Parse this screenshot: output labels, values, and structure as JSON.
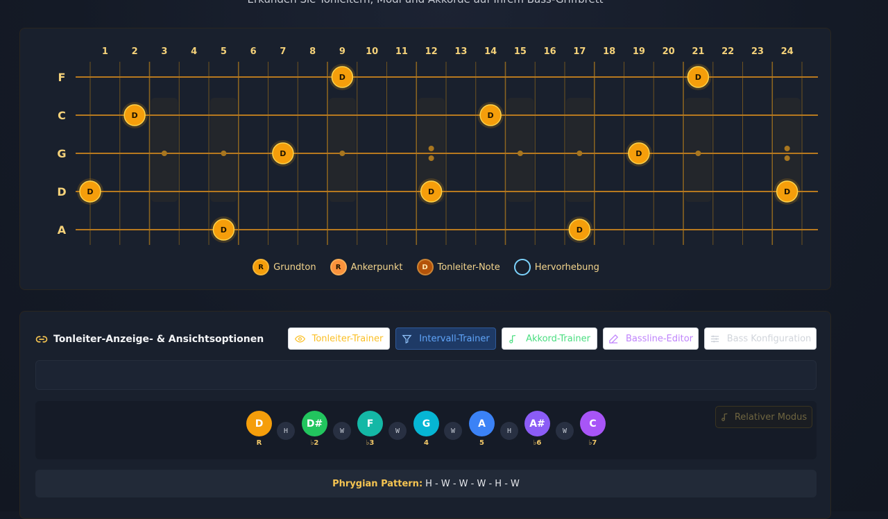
{
  "header": {
    "subtitle": "Erkunden Sie Tonleitern, Modi und Akkorde auf Ihrem Bass-Griffbrett"
  },
  "fretboard": {
    "fret_numbers": [
      "1",
      "2",
      "3",
      "4",
      "5",
      "6",
      "7",
      "8",
      "9",
      "10",
      "11",
      "12",
      "13",
      "14",
      "15",
      "16",
      "17",
      "18",
      "19",
      "20",
      "21",
      "22",
      "23",
      "24"
    ],
    "strings": [
      {
        "name": "F",
        "notes": [
          9,
          21
        ]
      },
      {
        "name": "C",
        "notes": [
          2,
          14
        ]
      },
      {
        "name": "G",
        "notes": [
          7,
          19
        ]
      },
      {
        "name": "D",
        "notes": [
          0,
          12,
          24
        ]
      },
      {
        "name": "A",
        "notes": [
          5,
          17
        ]
      }
    ],
    "note_label": "D",
    "single_inlays": [
      3,
      5,
      9,
      15,
      17,
      21
    ],
    "double_inlays": [
      12,
      24
    ],
    "colors": {
      "string": "#b7791f",
      "fret": "#7a5a1c",
      "note": "#f59e0b",
      "label": "#f5d27a"
    }
  },
  "legend": [
    {
      "symbol": "R",
      "label": "Grundton",
      "color": "#f59e0b"
    },
    {
      "symbol": "R",
      "label": "Ankerpunkt",
      "color": "#fb923c"
    },
    {
      "symbol": "D",
      "label": "Tonleiter-Note",
      "color": "#b45309"
    },
    {
      "symbol": "",
      "label": "Hervorhebung",
      "color": "#7dd3fc"
    }
  ],
  "options": {
    "title": "Tonleiter-Anzeige- & Ansichtsoptionen",
    "buttons": [
      {
        "label": "Tonleiter-Trainer",
        "icon": "eye-icon",
        "color": "#fbbf24"
      },
      {
        "label": "Intervall-Trainer",
        "icon": "filter-icon",
        "color": "#60a5fa"
      },
      {
        "label": "Akkord-Trainer",
        "icon": "music-note-icon",
        "color": "#4ade80"
      },
      {
        "label": "Bassline-Editor",
        "icon": "pencil-icon",
        "color": "#c084fc"
      },
      {
        "label": "Bass Konfiguration",
        "icon": "sliders-icon",
        "color": "#d1d5db"
      }
    ],
    "relative_mode_label": "Relativer Modus",
    "scale_notes": [
      {
        "note": "D",
        "degree": "R",
        "color": "#f59e0b"
      },
      {
        "note": "D#",
        "degree": "♭2",
        "color": "#22c55e"
      },
      {
        "note": "F",
        "degree": "♭3",
        "color": "#14b8a6"
      },
      {
        "note": "G",
        "degree": "4",
        "color": "#06b6d4"
      },
      {
        "note": "A",
        "degree": "5",
        "color": "#3b82f6"
      },
      {
        "note": "A#",
        "degree": "♭6",
        "color": "#8b5cf6"
      },
      {
        "note": "C",
        "degree": "♭7",
        "color": "#a855f7"
      }
    ],
    "steps": [
      "H",
      "W",
      "W",
      "W",
      "H",
      "W"
    ],
    "pattern_label": "Phrygian Pattern:",
    "pattern_value": "H - W - W - W - H - W"
  }
}
